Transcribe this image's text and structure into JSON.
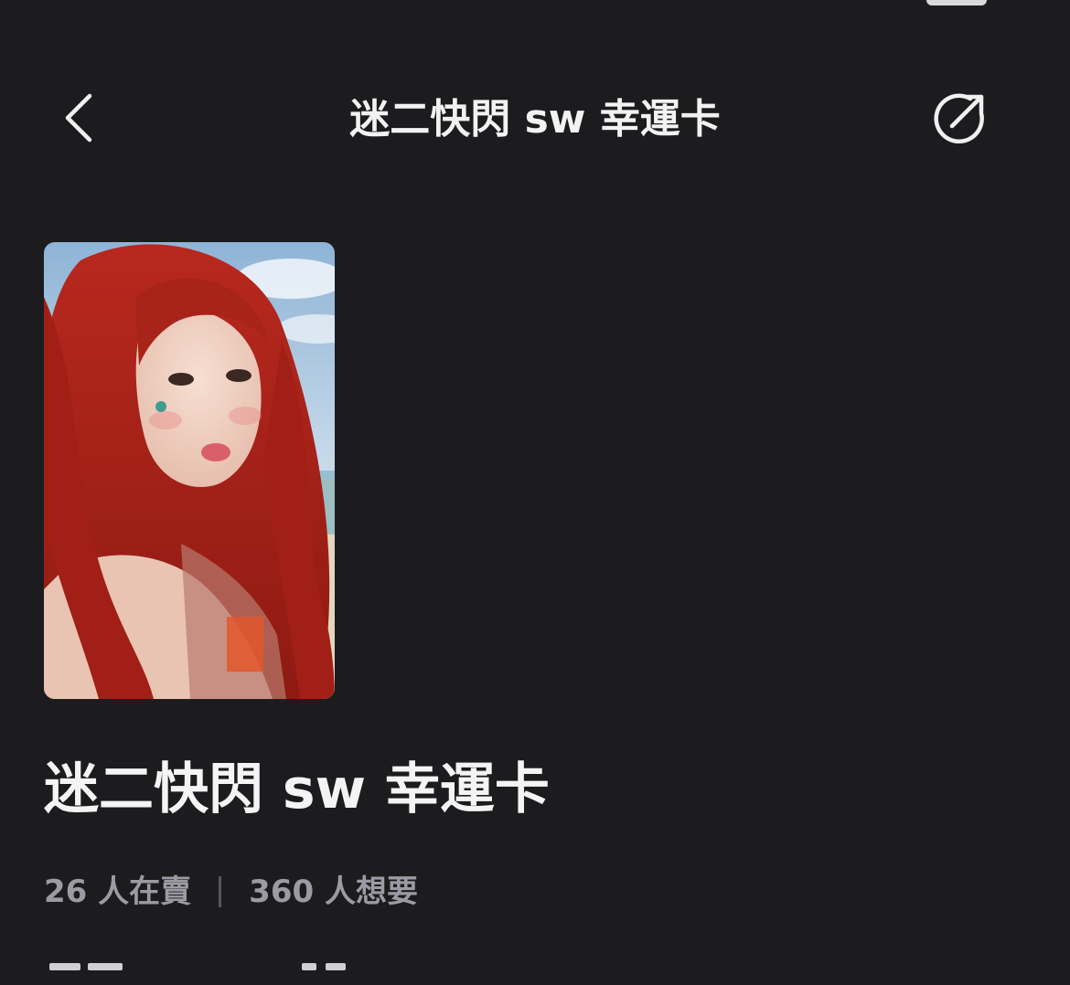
{
  "nav": {
    "title": "迷二快閃 sw 幸運卡",
    "back_icon": "chevron-left-icon",
    "share_icon": "share-external-icon"
  },
  "card": {
    "image": "photocard-red-hair-girl"
  },
  "product": {
    "title": "迷二快閃 sw 幸運卡",
    "selling": "26 人在賣",
    "wanting": "360 人想要"
  },
  "colors": {
    "background": "#1c1c1f",
    "title": "#f4f4f4",
    "stats": "#9b9ba3"
  }
}
